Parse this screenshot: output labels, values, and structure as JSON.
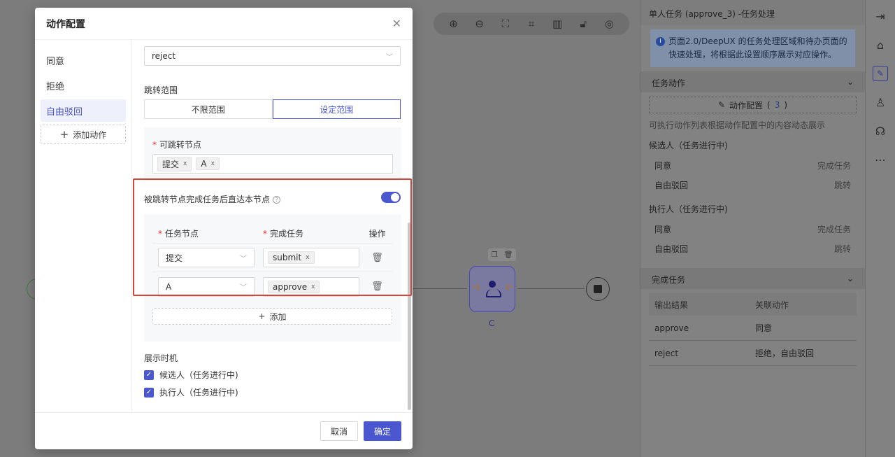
{
  "canvas": {
    "node_label": "C",
    "toolbar_icons": [
      "zoom-in-icon",
      "zoom-out-icon",
      "fit-screen-icon",
      "center-icon",
      "layout-icon",
      "unlock-icon",
      "eye-hidden-icon"
    ]
  },
  "right_panel": {
    "header": "单人任务 (approve_3) -任务处理",
    "info_text": "页面2.0/DeepUX 的任务处理区域和待办页面的快速处理，将根据此设置顺序展示对应操作。",
    "task_actions": {
      "title": "任务动作",
      "config_button": "动作配置",
      "config_count_open": "(",
      "config_count": "3",
      "config_count_close": ")",
      "hint": "可执行动作列表根据动作配置中的内容动态展示",
      "groups": [
        {
          "title": "候选人（任务进行中)",
          "rows": [
            {
              "left": "同意",
              "right": "完成任务"
            },
            {
              "left": "自由驳回",
              "right": "跳转"
            }
          ]
        },
        {
          "title": "执行人（任务进行中)",
          "rows": [
            {
              "left": "同意",
              "right": "完成任务"
            },
            {
              "left": "自由驳回",
              "right": "跳转"
            }
          ]
        }
      ]
    },
    "complete_task": {
      "title": "完成任务",
      "columns": [
        "输出结果",
        "关联动作"
      ],
      "rows": [
        {
          "result": "approve",
          "action": "同意"
        },
        {
          "result": "reject",
          "action": "拒绝，自由驳回"
        }
      ]
    }
  },
  "modal": {
    "title": "动作配置",
    "sidebar": {
      "items": [
        {
          "label": "同意",
          "active": false
        },
        {
          "label": "拒绝",
          "active": false
        },
        {
          "label": "自由驳回",
          "active": true
        }
      ],
      "add_action": "添加动作"
    },
    "content": {
      "result_select": "reject",
      "jump_range_label": "跳转范围",
      "jump_range_options": [
        "不限范围",
        "设定范围"
      ],
      "jump_range_selected": "设定范围",
      "jumpable_nodes_label": "可跳转节点",
      "jumpable_nodes": [
        "提交",
        "A"
      ],
      "direct_return_label": "被跳转节点完成任务后直达本节点",
      "direct_return_enabled": true,
      "table": {
        "col_node": "任务节点",
        "col_task": "完成任务",
        "col_ops": "操作",
        "rows": [
          {
            "node": "提交",
            "task": "submit"
          },
          {
            "node": "A",
            "task": "approve"
          }
        ]
      },
      "add_row": "添加",
      "display_timing_label": "展示时机",
      "display_options": [
        {
          "label": "候选人（任务进行中)",
          "checked": true
        },
        {
          "label": "执行人（任务进行中)",
          "checked": true
        }
      ]
    },
    "footer": {
      "cancel": "取消",
      "ok": "确定"
    }
  }
}
